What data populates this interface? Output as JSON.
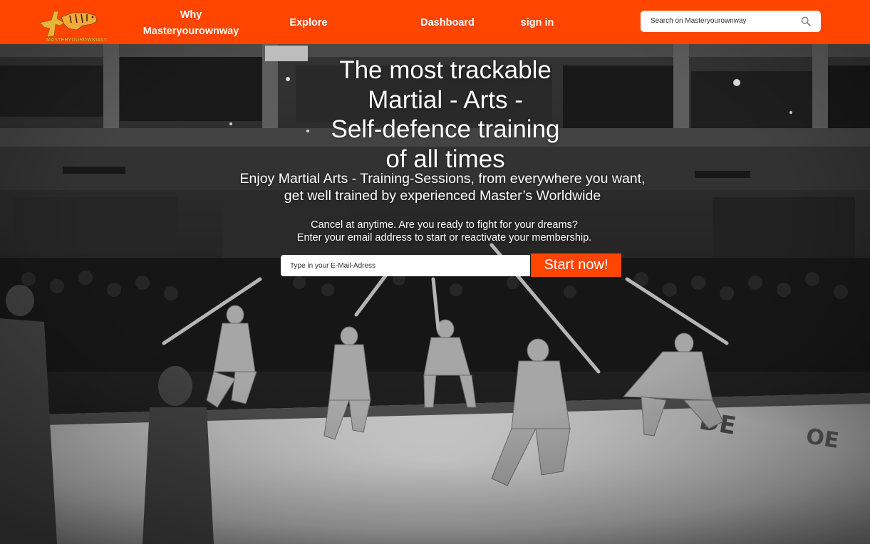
{
  "brand": {
    "logo_text": "MASTERYOUROWNWAY",
    "nav_color": "#ff4500",
    "accent_color": "#ff4500"
  },
  "nav": {
    "why_line1": "Why",
    "why_line2": "Masteryourownway",
    "explore": "Explore",
    "dashboard": "Dashboard",
    "sign_in": "sign in"
  },
  "search": {
    "placeholder": "Search on Masteryourownway",
    "icon": "search-icon"
  },
  "hero": {
    "headline_lines": [
      "The most trackable",
      "Martial - Arts -",
      "Self-defence training",
      "of all times"
    ],
    "subheadline_lines": [
      "Enjoy Martial Arts - Training-Sessions, from everywhere you want,",
      "get well trained by experienced Master’s Worldwide"
    ],
    "cancel_lines": [
      "Cancel at anytime. Are you ready to fight for your dreams?",
      "Enter your email address to start or reactivate your membership."
    ],
    "email_placeholder": "Type in your E-Mail-Adress",
    "cta_label": "Start now!"
  }
}
